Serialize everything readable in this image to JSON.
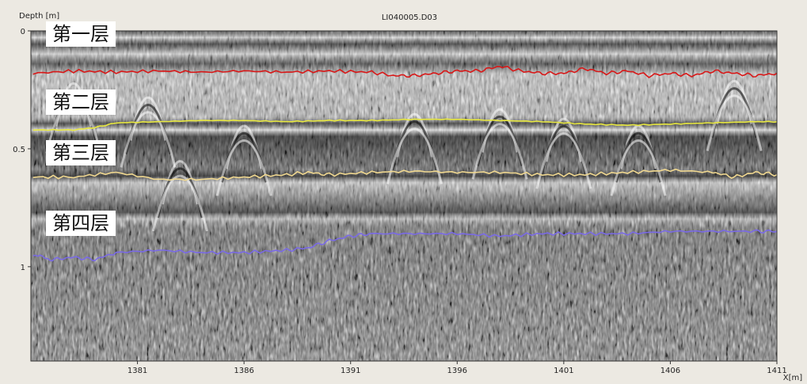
{
  "chart_data": {
    "type": "line",
    "title": "LI040005.D03",
    "ylabel": "Depth [m]",
    "xlabel": "X[m]",
    "xlim": [
      1376,
      1411
    ],
    "ylim": [
      0,
      1.4
    ],
    "y_inverted": true,
    "x_ticks": [
      1381,
      1386,
      1391,
      1396,
      1401,
      1406,
      1411
    ],
    "y_ticks": [
      "0",
      "0.5",
      "1"
    ],
    "background": "grayscale radargram",
    "series": [
      {
        "color": "#d81818",
        "x": [
          1376.1,
          1378,
          1380,
          1382,
          1384,
          1386,
          1388,
          1390,
          1392,
          1393,
          1394,
          1395,
          1396,
          1397,
          1398,
          1399,
          1400,
          1401,
          1402,
          1403,
          1404,
          1405,
          1406,
          1407,
          1408,
          1409,
          1410,
          1411
        ],
        "y": [
          0.18,
          0.17,
          0.175,
          0.17,
          0.175,
          0.17,
          0.175,
          0.17,
          0.175,
          0.19,
          0.19,
          0.18,
          0.17,
          0.17,
          0.15,
          0.17,
          0.18,
          0.18,
          0.16,
          0.18,
          0.17,
          0.19,
          0.18,
          0.19,
          0.17,
          0.18,
          0.19,
          0.18
        ]
      },
      {
        "color": "#e8e840",
        "x": [
          1376.1,
          1378,
          1379,
          1380,
          1382,
          1384,
          1386,
          1388,
          1390,
          1392,
          1394,
          1396,
          1398,
          1400,
          1402,
          1404,
          1406,
          1408,
          1410,
          1411
        ],
        "y": [
          0.42,
          0.42,
          0.41,
          0.39,
          0.385,
          0.38,
          0.38,
          0.385,
          0.38,
          0.38,
          0.375,
          0.375,
          0.38,
          0.385,
          0.395,
          0.4,
          0.395,
          0.39,
          0.385,
          0.385
        ]
      },
      {
        "color": "#f0d890",
        "x": [
          1376.1,
          1378,
          1380,
          1382,
          1384,
          1386,
          1388,
          1389,
          1390,
          1392,
          1394,
          1396,
          1398,
          1400,
          1402,
          1404,
          1406,
          1408,
          1409,
          1410,
          1411
        ],
        "y": [
          0.62,
          0.62,
          0.6,
          0.63,
          0.63,
          0.62,
          0.61,
          0.6,
          0.61,
          0.6,
          0.595,
          0.6,
          0.6,
          0.61,
          0.61,
          0.6,
          0.59,
          0.6,
          0.62,
          0.6,
          0.61
        ]
      },
      {
        "color": "#7a6ae6",
        "x": [
          1376.1,
          1377,
          1378,
          1379,
          1380,
          1382,
          1384,
          1386,
          1388,
          1389,
          1390,
          1391,
          1392,
          1394,
          1396,
          1398,
          1400,
          1402,
          1404,
          1406,
          1408,
          1410,
          1411
        ],
        "y": [
          0.95,
          0.97,
          0.96,
          0.97,
          0.94,
          0.93,
          0.94,
          0.94,
          0.93,
          0.92,
          0.89,
          0.87,
          0.86,
          0.86,
          0.86,
          0.87,
          0.86,
          0.86,
          0.86,
          0.85,
          0.85,
          0.85,
          0.85
        ]
      }
    ]
  },
  "layer_labels": [
    "第一层",
    "第二层",
    "第三层",
    "第四层"
  ]
}
